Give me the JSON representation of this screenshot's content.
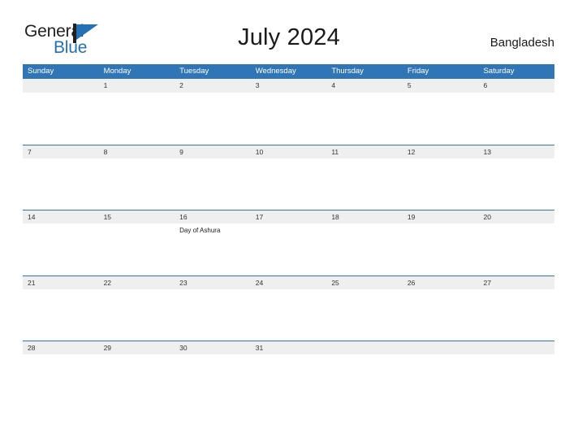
{
  "brand": {
    "word_one": "General",
    "word_two": "Blue",
    "flag_icon": "blue-flag-icon",
    "dark_color": "#231f20",
    "accent_color": "#2472b5"
  },
  "header": {
    "title": "July 2024",
    "locale": "Bangladesh"
  },
  "colors": {
    "header_blue": "#3075b5",
    "date_stripe": "#efefef",
    "text": "#333333",
    "page_background": "#ffffff"
  },
  "calendar": {
    "month": "July",
    "year": "2024",
    "weekdays": [
      "Sunday",
      "Monday",
      "Tuesday",
      "Wednesday",
      "Thursday",
      "Friday",
      "Saturday"
    ],
    "weeks": [
      [
        {
          "day": "",
          "events": []
        },
        {
          "day": "1",
          "events": []
        },
        {
          "day": "2",
          "events": []
        },
        {
          "day": "3",
          "events": []
        },
        {
          "day": "4",
          "events": []
        },
        {
          "day": "5",
          "events": []
        },
        {
          "day": "6",
          "events": []
        }
      ],
      [
        {
          "day": "7",
          "events": []
        },
        {
          "day": "8",
          "events": []
        },
        {
          "day": "9",
          "events": []
        },
        {
          "day": "10",
          "events": []
        },
        {
          "day": "11",
          "events": []
        },
        {
          "day": "12",
          "events": []
        },
        {
          "day": "13",
          "events": []
        }
      ],
      [
        {
          "day": "14",
          "events": []
        },
        {
          "day": "15",
          "events": []
        },
        {
          "day": "16",
          "events": [
            "Day of Ashura"
          ]
        },
        {
          "day": "17",
          "events": []
        },
        {
          "day": "18",
          "events": []
        },
        {
          "day": "19",
          "events": []
        },
        {
          "day": "20",
          "events": []
        }
      ],
      [
        {
          "day": "21",
          "events": []
        },
        {
          "day": "22",
          "events": []
        },
        {
          "day": "23",
          "events": []
        },
        {
          "day": "24",
          "events": []
        },
        {
          "day": "25",
          "events": []
        },
        {
          "day": "26",
          "events": []
        },
        {
          "day": "27",
          "events": []
        }
      ],
      [
        {
          "day": "28",
          "events": []
        },
        {
          "day": "29",
          "events": []
        },
        {
          "day": "30",
          "events": []
        },
        {
          "day": "31",
          "events": []
        },
        {
          "day": "",
          "events": []
        },
        {
          "day": "",
          "events": []
        },
        {
          "day": "",
          "events": []
        }
      ]
    ]
  }
}
